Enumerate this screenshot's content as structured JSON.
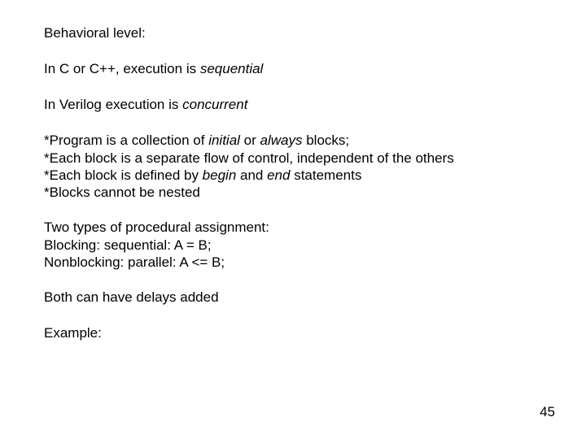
{
  "heading": "Behavioral level:",
  "para1_pre": "In C or C++, execution is ",
  "para1_em": "sequential",
  "para2_pre": "In Verilog execution is ",
  "para2_em": "concurrent",
  "bullets": {
    "b1_pre": "*Program is a collection of ",
    "b1_em1": "initial",
    "b1_mid": " or ",
    "b1_em2": "always",
    "b1_post": " blocks;",
    "b2": "*Each block is a separate flow of control, independent of the others",
    "b3_pre": "*Each block is defined by ",
    "b3_em1": "begin",
    "b3_mid": " and ",
    "b3_em2": "end",
    "b3_post": " statements",
    "b4": "*Blocks cannot be nested"
  },
  "assign": {
    "intro": "Two types of procedural assignment:",
    "blocking": "Blocking:  sequential:  A = B;",
    "nonblocking": "Nonblocking:  parallel: A <= B;"
  },
  "delays": "Both can have delays added",
  "example": "Example:",
  "page_number": "45"
}
